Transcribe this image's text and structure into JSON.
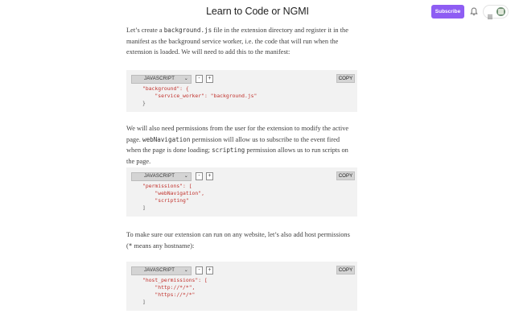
{
  "header": {
    "title": "Learn to Code or NGMI",
    "subscribe_label": "Subscribe"
  },
  "icons": {
    "bell": "bell-icon",
    "menu": "hamburger-menu-icon",
    "avatar": "user-avatar"
  },
  "colors": {
    "accent": "#8e5df3",
    "code_bg": "#f2f2f2",
    "string": "#c1322d"
  },
  "article": {
    "para1": {
      "before": "Let’s create a ",
      "code": "background.js",
      "after": " file in the extension directory and register it in the manifest as the background service worker, i.e. the code that will run when the extension is loaded. We will need to add this to the manifest:"
    },
    "para2": {
      "before": "We will also need permissions from the user for the extension to modify the active page. ",
      "code1": "webNavigation",
      "mid": " permission will allow us to subscribe to the event fired when the page is done loading; ",
      "code2": "scripting",
      "after": " permission allows us to run scripts on the page."
    },
    "para3": {
      "before": "To make sure our extension can run on any website, let’s also add host permissions (",
      "code": "*",
      "after": " means any hostname):"
    }
  },
  "code_blocks": [
    {
      "language": "JAVASCRIPT",
      "minus": "-",
      "plus": "+",
      "copy": "COPY",
      "lines": [
        "\"background\": {",
        "    \"service_worker\": \"background.js\"",
        "}"
      ]
    },
    {
      "language": "JAVASCRIPT",
      "minus": "-",
      "plus": "+",
      "copy": "COPY",
      "lines": [
        "\"permissions\": [",
        "    \"webNavigation\",",
        "    \"scripting\"",
        "]"
      ]
    },
    {
      "language": "JAVASCRIPT",
      "minus": "-",
      "plus": "+",
      "copy": "COPY",
      "lines": [
        "\"host_permissions\": [",
        "    \"http://*/*\",",
        "    \"https://*/*\"",
        "]"
      ]
    }
  ]
}
